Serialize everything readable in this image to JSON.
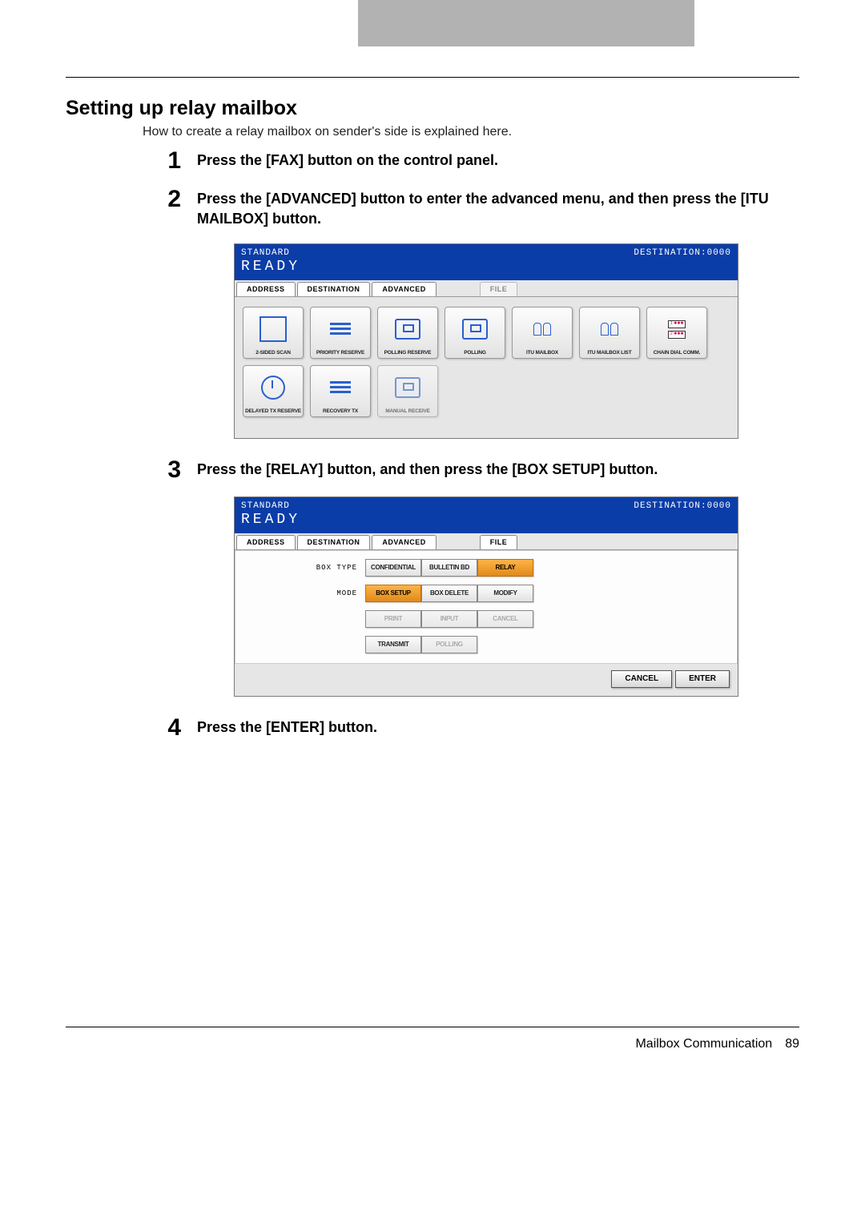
{
  "section_title": "Setting up relay mailbox",
  "intro": "How to create a relay mailbox on sender's side is explained here.",
  "steps": {
    "s1": {
      "num": "1",
      "text": "Press the [FAX] button on the control panel."
    },
    "s2": {
      "num": "2",
      "text": "Press the [ADVANCED] button to enter the advanced menu, and then press the [ITU MAILBOX] button."
    },
    "s3": {
      "num": "3",
      "text": "Press the [RELAY] button, and then press the [BOX SETUP] button."
    },
    "s4": {
      "num": "4",
      "text": "Press the [ENTER] button."
    }
  },
  "ss_header": {
    "standard": "STANDARD",
    "ready": "READY",
    "destination": "DESTINATION:0000"
  },
  "ss_tabs": {
    "address": "ADDRESS",
    "destination": "DESTINATION",
    "advanced": "ADVANCED",
    "file": "FILE"
  },
  "ss1_icons": {
    "row1": [
      "2-SIDED SCAN",
      "PRIORITY RESERVE",
      "POLLING RESERVE",
      "POLLING",
      "ITU MAILBOX",
      "ITU MAILBOX LIST",
      "CHAIN DIAL COMM."
    ],
    "row2": [
      "DELAYED TX RESERVE",
      "RECOVERY TX",
      "MANUAL RECEIVE"
    ]
  },
  "ss2": {
    "box_type_label": "BOX TYPE",
    "mode_label": "MODE",
    "box_type_buttons": [
      "CONFIDENTIAL",
      "BULLETIN BD",
      "RELAY"
    ],
    "mode_buttons": [
      "BOX SETUP",
      "BOX DELETE",
      "MODIFY"
    ],
    "extra_row1": [
      "PRINT",
      "INPUT",
      "CANCEL"
    ],
    "extra_row2": [
      "TRANSMIT",
      "POLLING"
    ],
    "footer": {
      "cancel": "CANCEL",
      "enter": "ENTER"
    }
  },
  "page_footer": {
    "label": "Mailbox Communication",
    "page_num": "89"
  }
}
